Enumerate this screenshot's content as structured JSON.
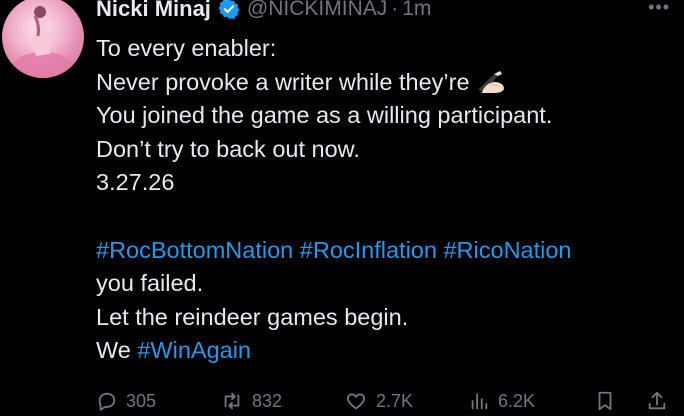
{
  "author": {
    "name": "Nicki Minaj",
    "handle": "@NICKIMINAJ",
    "separator": "·",
    "time": "1m",
    "verified_color": "#1d9bf0"
  },
  "body": {
    "lines": [
      "To every enabler:",
      "Never provoke a writer while they’re",
      "You joined the game as a willing participant.",
      "Don’t try to back out now.",
      "3.27.26"
    ],
    "hashtags": [
      "#RocBottomNation",
      "#RocInflation",
      "#RicoNation"
    ],
    "after_lines": [
      "you failed.",
      "Let the reindeer games begin."
    ],
    "last_line_prefix": "We",
    "last_hashtag": "#WinAgain",
    "hashtag_color": "#1d9bf0"
  },
  "actions": {
    "replies": "305",
    "reposts": "832",
    "likes": "2.7K",
    "views": "6.2K"
  },
  "icons": [
    "more-icon",
    "verified-badge-icon",
    "writing-hand-emoji",
    "reply-icon",
    "repost-icon",
    "like-icon",
    "views-icon",
    "bookmark-icon",
    "share-icon"
  ]
}
